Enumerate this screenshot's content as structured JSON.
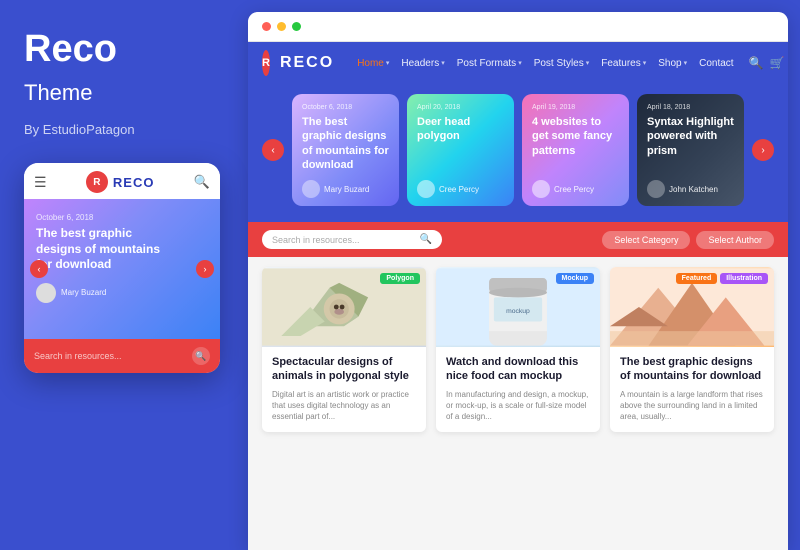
{
  "left_panel": {
    "brand_name": "Reco",
    "brand_subtitle": "Theme",
    "brand_by": "By EstudioPatagon"
  },
  "mobile": {
    "dots": [
      "#ff5f56",
      "#ffbd2e",
      "#27c93f"
    ],
    "logo_letter": "R",
    "logo_text": "RECO",
    "hero_date": "October 6, 2018",
    "hero_title": "The best graphic designs of mountains for download",
    "author_name": "Mary Buzard",
    "search_placeholder": "Search in resources...",
    "nav_left": "‹",
    "nav_right": "›"
  },
  "browser": {
    "dots": [
      "#ff5f56",
      "#ffbd2e",
      "#27c93f"
    ],
    "logo_letter": "R",
    "logo_text": "RECO",
    "nav_items": [
      {
        "label": "Home",
        "active": true,
        "has_dropdown": true
      },
      {
        "label": "Headers",
        "active": false,
        "has_dropdown": true
      },
      {
        "label": "Post Formats",
        "active": false,
        "has_dropdown": true
      },
      {
        "label": "Post Styles",
        "active": false,
        "has_dropdown": true
      },
      {
        "label": "Features",
        "active": false,
        "has_dropdown": true
      },
      {
        "label": "Shop",
        "active": false,
        "has_dropdown": true
      },
      {
        "label": "Contact",
        "active": false,
        "has_dropdown": false
      }
    ],
    "slider": {
      "left_btn": "‹",
      "right_btn": "›",
      "cards": [
        {
          "date": "October 6, 2018",
          "title": "The best graphic designs of mountains for download",
          "author": "Mary Buzard",
          "bg": "1"
        },
        {
          "date": "April 20, 2018",
          "title": "Deer head polygon",
          "author": "Cree Percy",
          "bg": "2"
        },
        {
          "date": "April 19, 2018",
          "title": "4 websites to get some fancy patterns",
          "author": "Cree Percy",
          "bg": "3"
        },
        {
          "date": "April 18, 2018",
          "title": "Syntax Highlight powered with prism",
          "author": "John Katchen",
          "bg": "4"
        }
      ]
    },
    "search_placeholder": "Search in resources...",
    "filter1": "Select Category",
    "filter2": "Select Author",
    "articles": [
      {
        "badge_text": "Polygon",
        "badge_color": "green",
        "title": "Spectacular designs of animals in polygonal style",
        "excerpt": "Digital art is an artistic work or practice that uses digital technology as an essential part of...",
        "img_type": "dog"
      },
      {
        "badge_text": "Mockup",
        "badge_color": "blue",
        "title": "Watch and download this nice food can mockup",
        "excerpt": "In manufacturing and design, a mockup, or mock-up, is a scale or full-size model of a design...",
        "img_type": "can"
      },
      {
        "badge_text": "Featured",
        "badge_color": "orange",
        "badge2_text": "Illustration",
        "badge2_color": "purple",
        "title": "The best graphic designs of mountains for download",
        "excerpt": "A mountain is a large landform that rises above the surrounding land in a limited area, usually...",
        "img_type": "mountain"
      }
    ]
  }
}
